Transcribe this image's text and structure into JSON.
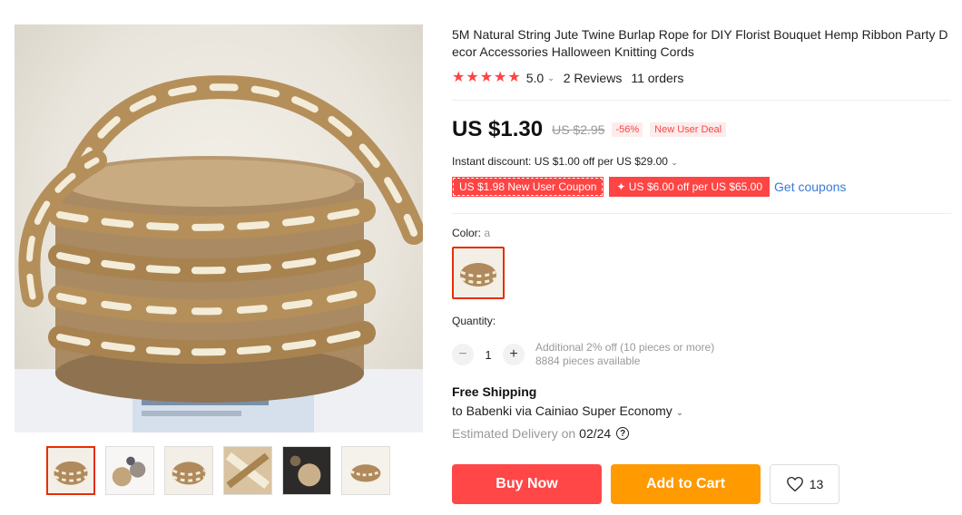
{
  "product": {
    "title": "5M Natural String Jute Twine Burlap Rope for DIY Florist Bouquet Hemp Ribbon Party Decor Accessories Halloween Knitting Cords",
    "rating": "5.0",
    "reviews": "2 Reviews",
    "orders": "11 orders",
    "stars": 5
  },
  "price": {
    "current": "US $1.30",
    "original": "US $2.95",
    "discount": "-56%",
    "deal_badge": "New User Deal"
  },
  "promotions": {
    "instant_discount": "Instant discount: US $1.00 off per US $29.00",
    "coupon_1": "US $1.98 New User Coupon",
    "coupon_2": "✦ US $6.00 off per US $65.00",
    "get_coupons": "Get coupons"
  },
  "variant": {
    "color_label": "Color:",
    "color_value": "a"
  },
  "quantity": {
    "label": "Quantity:",
    "value": "1",
    "minus": "−",
    "plus": "+",
    "bulk_note": "Additional 2% off (10 pieces or more)",
    "available": "8884 pieces available"
  },
  "shipping": {
    "title": "Free Shipping",
    "to": "to Babenki via Cainiao Super Economy",
    "delivery_prefix": "Estimated Delivery on",
    "delivery_date": "02/24",
    "help": "?"
  },
  "actions": {
    "buy_now": "Buy Now",
    "add_to_cart": "Add to Cart",
    "wishlist_count": "13"
  },
  "colors": {
    "accent": "#ff4747",
    "cart": "#ff9a00",
    "link": "#3a7bd5",
    "price_red": "#ff4444"
  },
  "icons": [
    "star-icon",
    "chevron-down-icon",
    "help-icon",
    "heart-icon"
  ]
}
